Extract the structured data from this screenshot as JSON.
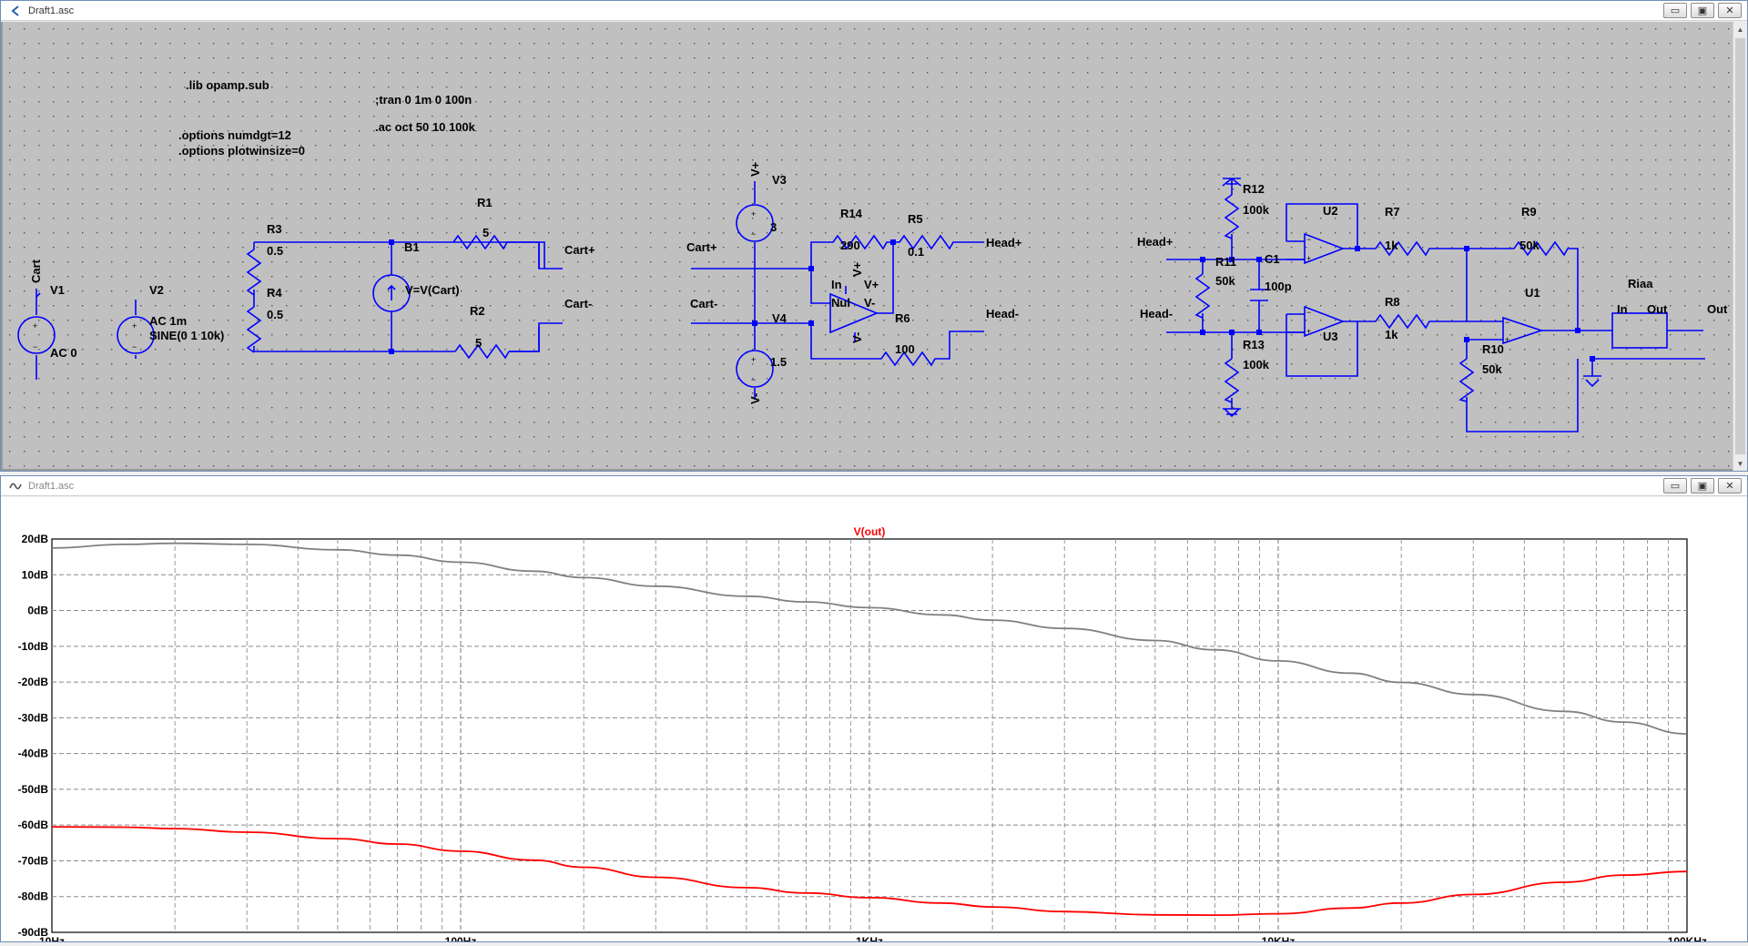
{
  "schematic_window": {
    "title": "Draft1.asc"
  },
  "plot_window": {
    "title": "Draft1.asc"
  },
  "window_controls": {
    "minimize": "▭",
    "restore": "▣",
    "close": "✕"
  },
  "directives": {
    "lib": ".lib opamp.sub",
    "tran": ";tran 0 1m 0 100n",
    "ac": ".ac oct 50 10 100k",
    "opt1": ".options numdgt=12",
    "opt2": ".options plotwinsize=0"
  },
  "components": {
    "cart_net": "Cart",
    "v1": {
      "name": "V1",
      "value": "AC 0"
    },
    "v2": {
      "name": "V2",
      "value1": "AC 1m",
      "value2": "SINE(0 1 10k)"
    },
    "r3": {
      "name": "R3",
      "value": "0.5"
    },
    "r4": {
      "name": "R4",
      "value": "0.5"
    },
    "b1": {
      "name": "B1",
      "value": "V=V(Cart)"
    },
    "r1": {
      "name": "R1",
      "value": "5"
    },
    "r2": {
      "name": "R2",
      "value": "5"
    },
    "cart_plus": "Cart+",
    "cart_minus": "Cart-",
    "vplus": "V+",
    "vminus": "V-",
    "v3": {
      "name": "V3",
      "value": "3"
    },
    "v4": {
      "name": "V4",
      "value": "1.5"
    },
    "r14": {
      "name": "R14",
      "value": "290"
    },
    "r5": {
      "name": "R5",
      "value": "0.1"
    },
    "r6": {
      "name": "R6",
      "value": "100"
    },
    "null_block": {
      "in": "In",
      "nul": "Nul",
      "vp": "V+",
      "vm": "V-"
    },
    "head_plus": "Head+",
    "head_minus": "Head-",
    "r12": {
      "name": "R12",
      "value": "100k"
    },
    "r11": {
      "name": "R11",
      "value": "50k"
    },
    "r13": {
      "name": "R13",
      "value": "100k"
    },
    "c1": {
      "name": "C1",
      "value": "100p"
    },
    "u2": "U2",
    "u3": "U3",
    "u1": "U1",
    "r7": {
      "name": "R7",
      "value": "1k"
    },
    "r8": {
      "name": "R8",
      "value": "1k"
    },
    "r9": {
      "name": "R9",
      "value": "50k"
    },
    "r10": {
      "name": "R10",
      "value": "50k"
    },
    "riaa": {
      "name": "Riaa",
      "in": "In",
      "out": "Out"
    },
    "out_net": "Out"
  },
  "colors": {
    "wire": "#0000ff",
    "text": "#000000",
    "gain_trace": "#808080",
    "phase_trace": "#ff0000",
    "trace_label": "#ff0000"
  },
  "chart_data": {
    "type": "line",
    "title": "V(out)",
    "x_scale": "log",
    "xlim": [
      10,
      100000
    ],
    "ylim": [
      -90,
      20
    ],
    "x_tick_labels": [
      "10Hz",
      "100Hz",
      "1KHz",
      "10KHz",
      "100KHz"
    ],
    "y_tick_labels": [
      "20dB",
      "10dB",
      "0dB",
      "-10dB",
      "-20dB",
      "-30dB",
      "-40dB",
      "-50dB",
      "-60dB",
      "-70dB",
      "-80dB",
      "-90dB"
    ],
    "grid": true,
    "series": [
      {
        "color": "#808080",
        "x": [
          10,
          15,
          20,
          30,
          50,
          70,
          100,
          150,
          200,
          300,
          500,
          700,
          1000,
          1500,
          2000,
          3000,
          5000,
          7000,
          10000,
          15000,
          20000,
          30000,
          50000,
          70000,
          100000
        ],
        "y": [
          17.5,
          18.5,
          18.8,
          18.5,
          17,
          15.5,
          13.5,
          11,
          9.2,
          6.8,
          4,
          2.4,
          0.8,
          -1.2,
          -2.7,
          -5,
          -8.4,
          -11,
          -14.1,
          -17.5,
          -20.1,
          -23.5,
          -28.2,
          -31.2,
          -34.5
        ]
      },
      {
        "color": "#ff0000",
        "x": [
          10,
          15,
          20,
          30,
          50,
          70,
          100,
          150,
          200,
          300,
          500,
          700,
          1000,
          1500,
          2000,
          3000,
          5000,
          7000,
          10000,
          15000,
          20000,
          30000,
          50000,
          70000,
          100000
        ],
        "y": [
          -60.5,
          -60.6,
          -61,
          -62,
          -63.8,
          -65.3,
          -67.3,
          -69.8,
          -71.8,
          -74.6,
          -77.5,
          -79,
          -80.3,
          -81.8,
          -82.9,
          -84.2,
          -85.1,
          -85.2,
          -84.8,
          -83.2,
          -81.8,
          -79.4,
          -76,
          -74,
          -73
        ]
      }
    ]
  }
}
